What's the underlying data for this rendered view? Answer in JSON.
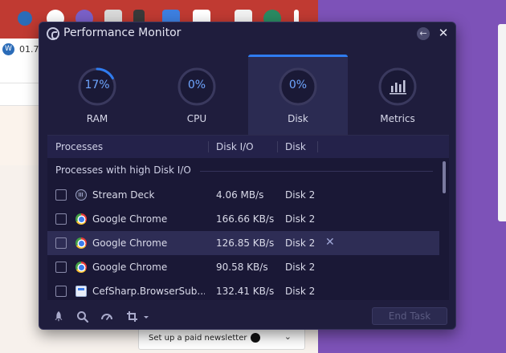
{
  "window": {
    "title": "Performance Monitor",
    "back_label": "←",
    "close_label": "✕"
  },
  "background": {
    "wp_text": "01.7",
    "newsletter_text": "Set up a paid newsletter",
    "newsletter_chevron": "⌄"
  },
  "tabs": [
    {
      "label": "RAM",
      "value": "17%",
      "percent": 17,
      "active": false
    },
    {
      "label": "CPU",
      "value": "0%",
      "percent": 0,
      "active": false
    },
    {
      "label": "Disk",
      "value": "0%",
      "percent": 0,
      "active": true
    },
    {
      "label": "Metrics",
      "value": "",
      "icon": "bar-chart-icon",
      "active": false
    }
  ],
  "table": {
    "headers": {
      "processes": "Processes",
      "io": "Disk I/O",
      "disk": "Disk"
    },
    "group_label": "Processes with high Disk I/O",
    "rows": [
      {
        "name": "Stream Deck",
        "io": "4.06 MB/s",
        "disk": "Disk 2",
        "icon": "stream-deck-icon"
      },
      {
        "name": "Google Chrome",
        "io": "166.66 KB/s",
        "disk": "Disk 2",
        "icon": "chrome-icon"
      },
      {
        "name": "Google Chrome",
        "io": "126.85 KB/s",
        "disk": "Disk 2",
        "icon": "chrome-icon",
        "hovered": true,
        "remove_label": "✕"
      },
      {
        "name": "Google Chrome",
        "io": "90.58 KB/s",
        "disk": "Disk 2",
        "icon": "chrome-icon"
      },
      {
        "name": "CefSharp.BrowserSub...",
        "io": "132.41 KB/s",
        "disk": "Disk 2",
        "icon": "cefsharp-icon"
      }
    ]
  },
  "toolbar": {
    "icons": [
      "rocket-icon",
      "search-icon",
      "speed-icon",
      "crop-icon"
    ],
    "end_task_label": "End Task"
  },
  "colors": {
    "window_bg": "#1f1d3d",
    "accent": "#2f7cf0",
    "gauge_text": "#6fa6ff"
  }
}
